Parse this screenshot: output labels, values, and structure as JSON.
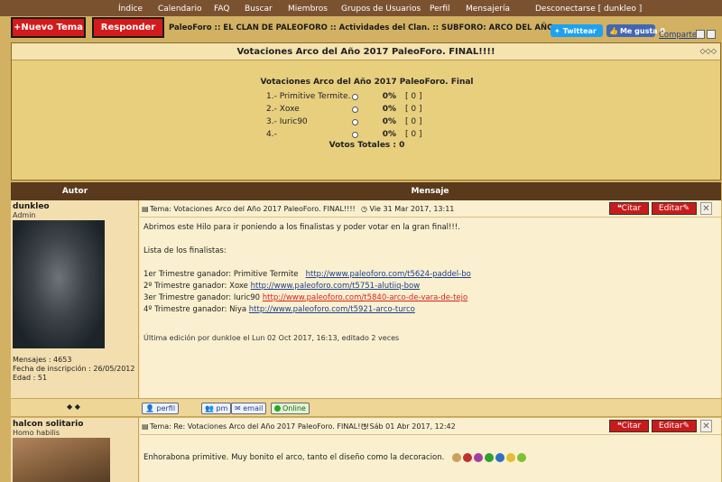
{
  "nav": [
    "Índice",
    "Calendario",
    "FAQ",
    "Buscar",
    "Miembros",
    "Grupos de Usuarios",
    "Perfil",
    "Mensajería",
    "Desconectarse [ dunkleo ]"
  ],
  "buttons": {
    "new_topic": "+Nuevo Tema",
    "reply": "Responder"
  },
  "breadcrumb": "PaleoForo :: EL CLAN DE PALEOFORO :: Actividades del Clan. :: SUBFORO: ARCO DEL AÑO",
  "social": {
    "twitter": "Twittear",
    "facebook": "Me gusta 0",
    "share": "Comparte"
  },
  "topic_title": "Votaciones Arco del Año 2017 PaleoForo. FINAL!!!!",
  "poll": {
    "title": "Votaciones Arco del Año 2017 PaleoForo. Final",
    "options": [
      {
        "label": "1.- Primitive Termite.",
        "pct": "0%",
        "votes": "[ 0 ]"
      },
      {
        "label": "2.- Xoxe",
        "pct": "0%",
        "votes": "[ 0 ]"
      },
      {
        "label": "3.- Iuric90",
        "pct": "0%",
        "votes": "[ 0 ]"
      },
      {
        "label": "4.-",
        "pct": "0%",
        "votes": "[ 0 ]"
      }
    ],
    "total": "Votos Totales : 0"
  },
  "table_headers": {
    "author": "Autor",
    "message": "Mensaje"
  },
  "posts": [
    {
      "author": "dunkleo",
      "rank": "Admin",
      "stats": [
        "Mensajes : 4653",
        "Fecha de inscripción : 26/05/2012",
        "Edad : 51"
      ],
      "subject": "Tema: Votaciones Arco del Año 2017 PaleoForo. FINAL!!!!",
      "date": "Vie 31 Mar 2017, 13:11",
      "lines": {
        "l1": "Abrimos este Hilo para ir poniendo a los finalistas y poder votar en la gran final!!!.",
        "l2": "Lista de los finalistas:",
        "w1": "1er Trimestre ganador: Primitive Termite",
        "w1_link": "http://www.paleoforo.com/t5624-paddel-bo",
        "w2": "2º  Trimestre ganador: Xoxe",
        "w2_link": "http://www.paleoforo.com/t5751-alutiiq-bow",
        "w3": "3er Trimestre ganador: Iuric90",
        "w3_link": "http://www.paleoforo.com/t5840-arco-de-vara-de-tejo",
        "w4": "4º  Trimestre ganador: Niya",
        "w4_link": "http://www.paleoforo.com/t5921-arco-turco"
      },
      "edited": "Última edición por dunkloe el Lun 02 Oct 2017, 16:13, editado 2 veces"
    },
    {
      "author": "halcon solitario",
      "rank": "Homo habilis",
      "subject": "Tema: Re: Votaciones Arco del Año 2017 PaleoForo. FINAL!!!!",
      "date": "Sáb 01 Abr 2017, 12:42",
      "text": "Enhorabona primitive. Muy bonito el arco, tanto el diseño como la decoracion."
    }
  ],
  "post_buttons": {
    "quote": "Citar",
    "edit": "Editar"
  },
  "profile_buttons": {
    "profile": "perfil",
    "pm": "pm",
    "email": "email",
    "online": "Online"
  },
  "colors": {
    "nav_bg": "#7a5230",
    "button_red": "#d41b1b",
    "header_brown": "#5a3a1c",
    "page_bg": "#d2b163"
  }
}
